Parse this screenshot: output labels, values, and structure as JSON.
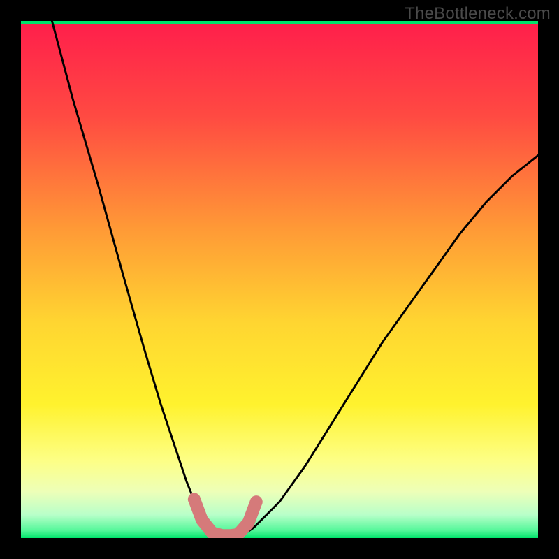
{
  "watermark": "TheBottleneck.com",
  "gradient_colors": {
    "top": "#ff1f4b",
    "mid_upper": "#ff843a",
    "mid": "#ffd531",
    "mid_lower": "#fff97a",
    "pale": "#e7ffb8",
    "green_light": "#8fffb3",
    "green": "#00e36b"
  },
  "curve_color": "#000000",
  "marker_color": "#d57a7a",
  "chart_data": {
    "type": "line",
    "title": "",
    "xlabel": "",
    "ylabel": "",
    "xlim": [
      0,
      100
    ],
    "ylim": [
      0,
      100
    ],
    "annotations": [
      "TheBottleneck.com"
    ],
    "series": [
      {
        "name": "bottleneck-curve",
        "x": [
          6,
          10,
          15,
          20,
          24,
          27,
          30,
          32,
          34,
          36,
          38,
          40,
          42,
          45,
          50,
          55,
          60,
          65,
          70,
          75,
          80,
          85,
          90,
          95,
          100
        ],
        "y": [
          100,
          85,
          68,
          50,
          36,
          26,
          17,
          11,
          6,
          3,
          1,
          0,
          0,
          2,
          7,
          14,
          22,
          30,
          38,
          45,
          52,
          59,
          65,
          70,
          74
        ]
      },
      {
        "name": "optimal-markers",
        "x": [
          33.5,
          35,
          37,
          39,
          40.5,
          42,
          44,
          45.5
        ],
        "y": [
          7.5,
          3.5,
          1,
          0.5,
          0.5,
          0.7,
          3,
          7
        ]
      }
    ],
    "background": "vertical-gradient-red-orange-yellow-green"
  }
}
